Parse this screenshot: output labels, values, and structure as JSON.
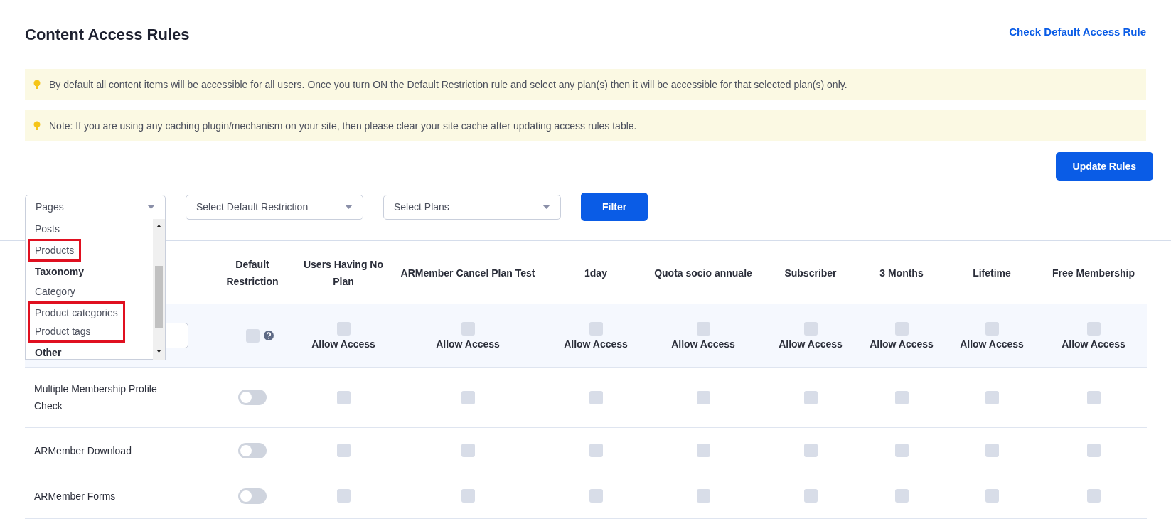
{
  "page": {
    "title": "Content Access Rules",
    "link": "Check Default Access Rule"
  },
  "notices": [
    "By default all content items will be accessible for all users. Once you turn ON the Default Restriction rule and select any plan(s) then it will be accessible for that selected plan(s) only.",
    "Note: If you are using any caching plugin/mechanism on your site, then please clear your site cache after updating access rules table."
  ],
  "update_button": "Update Rules",
  "filters": {
    "selects": [
      {
        "value": "Pages",
        "expanded": true
      },
      {
        "value": "Select Default Restriction",
        "expanded": false
      },
      {
        "value": "Select Plans",
        "expanded": false
      }
    ],
    "button": "Filter"
  },
  "dropdown": {
    "items": [
      {
        "label": "Posts",
        "kind": "option",
        "highlighted": false
      },
      {
        "label": "Products",
        "kind": "option",
        "highlighted": true
      },
      {
        "label": "Taxonomy",
        "kind": "group",
        "highlighted": false
      },
      {
        "label": "Category",
        "kind": "option",
        "highlighted": false
      },
      {
        "label": "Product categories",
        "kind": "option",
        "highlighted": true
      },
      {
        "label": "Product tags",
        "kind": "option",
        "highlighted": true
      },
      {
        "label": "Other",
        "kind": "group",
        "highlighted": false
      }
    ]
  },
  "table": {
    "default_column": "Default Restriction",
    "plans": [
      "Users Having No Plan",
      "ARMember Cancel Plan Test",
      "1day",
      "Quota socio annuale",
      "Subscriber",
      "3 Months",
      "Lifetime",
      "Free Membership"
    ],
    "filter_row": {
      "default_checked": false,
      "plans": [
        {
          "label": "Allow Access",
          "checked": false
        },
        {
          "label": "Allow Access",
          "checked": false
        },
        {
          "label": "Allow Access",
          "checked": false
        },
        {
          "label": "Allow Access",
          "checked": false
        },
        {
          "label": "Allow Access",
          "checked": false
        },
        {
          "label": "Allow Access",
          "checked": false
        },
        {
          "label": "Allow Access",
          "checked": false
        },
        {
          "label": "Allow Access",
          "checked": false
        }
      ]
    },
    "rows": [
      {
        "name": "Multiple Membership Profile Check",
        "on": false,
        "access": [
          false,
          false,
          false,
          false,
          false,
          false,
          false,
          false
        ]
      },
      {
        "name": "ARMember Download",
        "on": false,
        "access": [
          false,
          false,
          false,
          false,
          false,
          false,
          false,
          false
        ]
      },
      {
        "name": "ARMember Forms",
        "on": false,
        "access": [
          false,
          false,
          false,
          false,
          false,
          false,
          false,
          false
        ]
      }
    ]
  }
}
